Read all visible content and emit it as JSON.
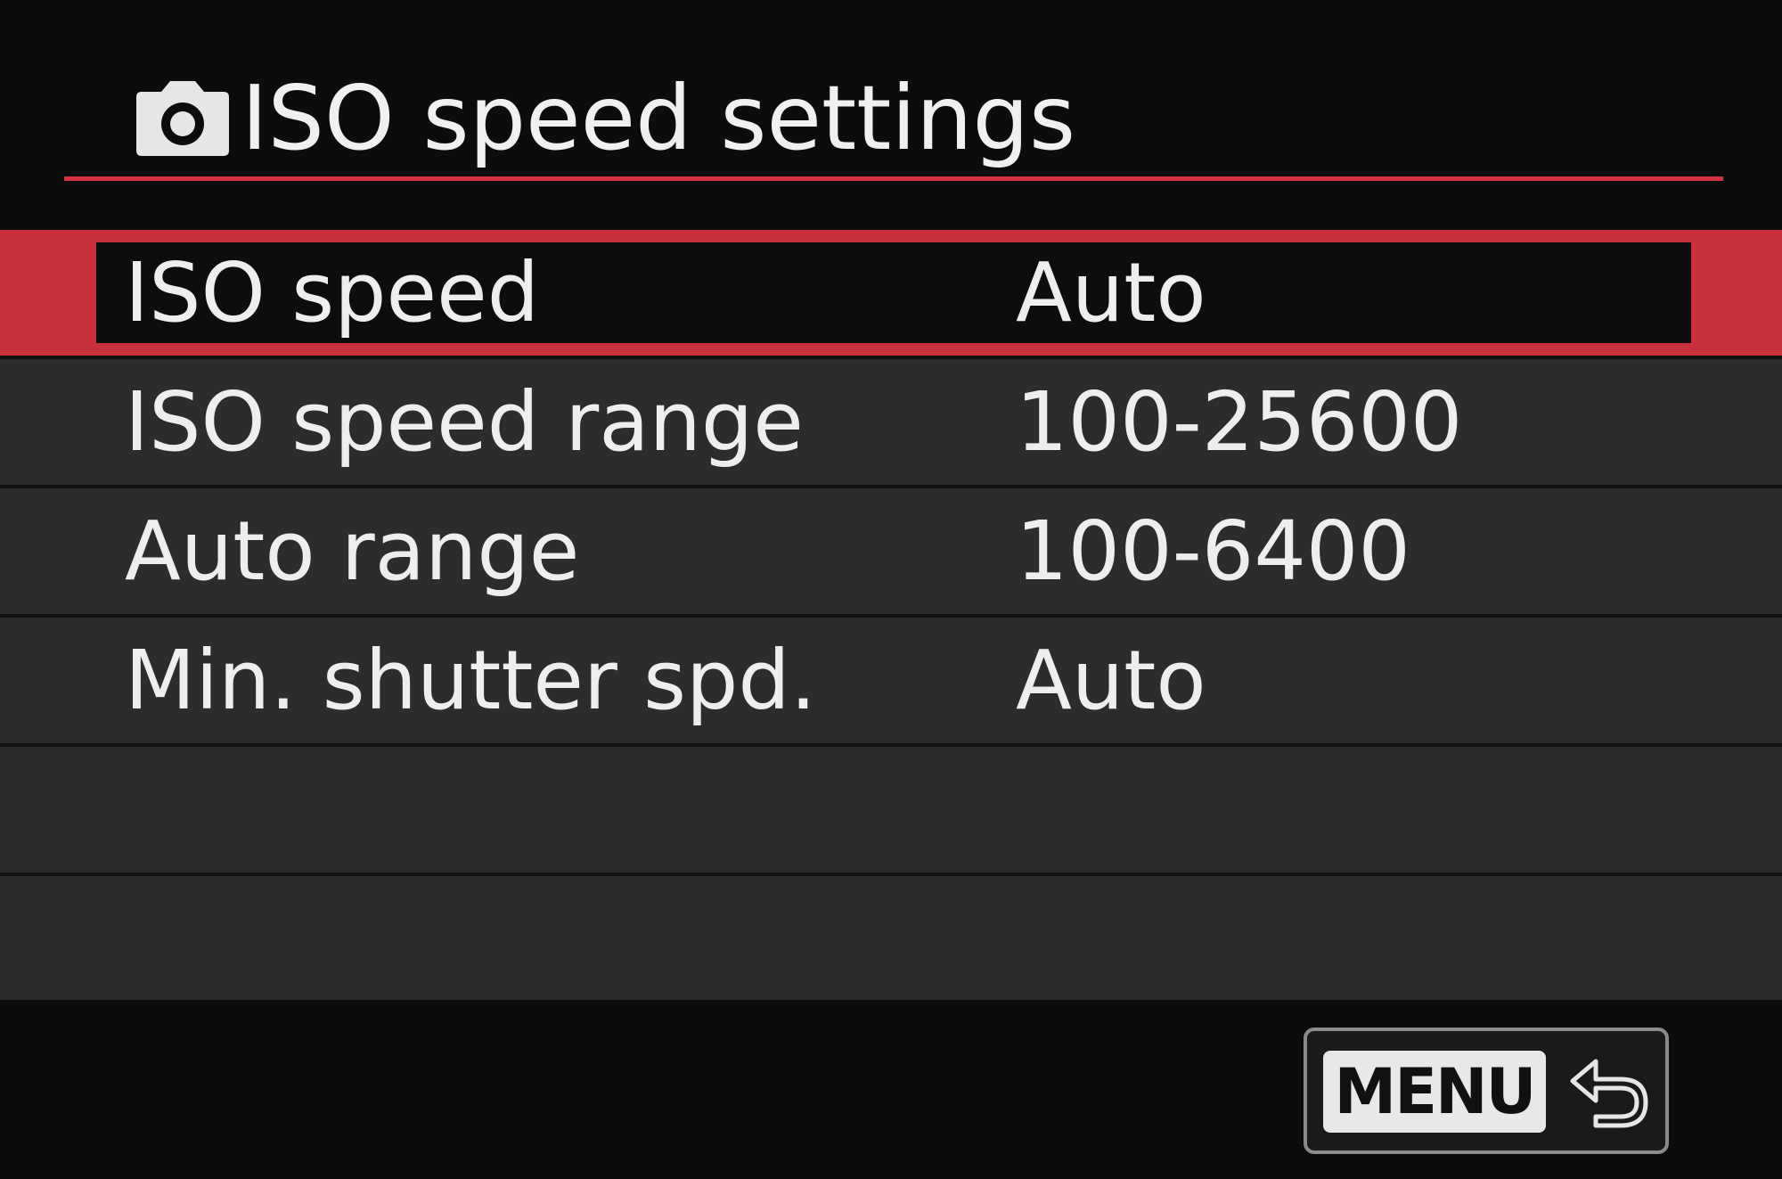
{
  "header": {
    "icon": "camera-icon",
    "title": "ISO speed settings"
  },
  "colors": {
    "accent": "#c8303c",
    "row_bg": "#2c2c2c",
    "background": "#0c0c0c",
    "text": "#eeeeee"
  },
  "menu": {
    "items": [
      {
        "label": "ISO speed",
        "value": "Auto",
        "selected": true
      },
      {
        "label": "ISO speed range",
        "value": "100-25600",
        "selected": false
      },
      {
        "label": "Auto range",
        "value": "100-6400",
        "selected": false
      },
      {
        "label": "Min. shutter spd.",
        "value": "Auto",
        "selected": false
      }
    ]
  },
  "footer": {
    "menu_button_label": "MENU",
    "return_icon": "return-arrow-icon"
  }
}
